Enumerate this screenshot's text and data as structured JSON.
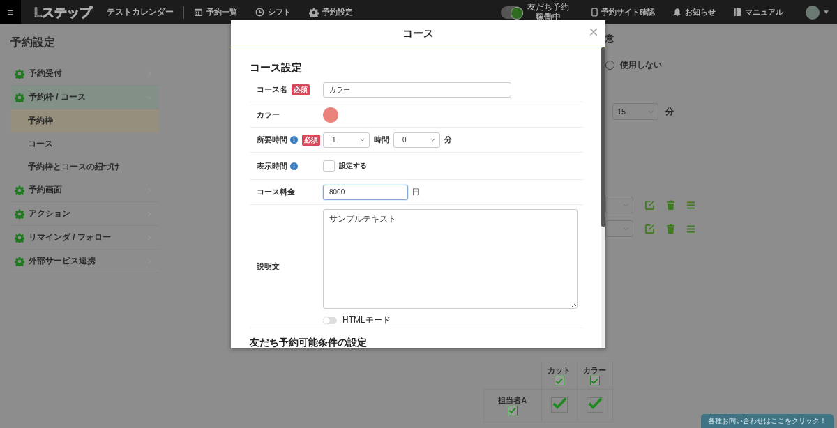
{
  "topbar": {
    "menu": "≡",
    "logo": "Lステップ",
    "calendar_name": "テストカレンダー",
    "nav": [
      {
        "label": "予約一覧"
      },
      {
        "label": "シフト"
      },
      {
        "label": "予約設定"
      }
    ],
    "status_toggle": {
      "caption": "友だち予約",
      "label": "稼働中",
      "on": true
    },
    "links": [
      {
        "label": "予約サイト確認"
      },
      {
        "label": "お知らせ"
      },
      {
        "label": "マニュアル"
      }
    ]
  },
  "sidebar": {
    "title": "予約設定",
    "items": [
      {
        "label": "予約受付",
        "expanded": false
      },
      {
        "label": "予約枠 / コース",
        "expanded": true,
        "children": [
          {
            "label": "予約枠",
            "selected": true
          },
          {
            "label": "コース",
            "selected": false
          },
          {
            "label": "予約枠とコースの紐づけ",
            "selected": false
          }
        ]
      },
      {
        "label": "予約画面",
        "expanded": false
      },
      {
        "label": "アクション",
        "expanded": false
      },
      {
        "label": "リマインダ / フォロー",
        "expanded": false
      },
      {
        "label": "外部サービス連携",
        "expanded": false
      }
    ]
  },
  "background": {
    "heading_fragment": "意",
    "radio": {
      "label": "使用しない",
      "selected": false
    },
    "interval": {
      "value": "15",
      "unit": "分"
    },
    "rows": [
      {
        "actions": true
      },
      {
        "actions": true
      }
    ],
    "table": {
      "columns": [
        {
          "label": "カット",
          "checked": true
        },
        {
          "label": "カラー",
          "checked": true
        }
      ],
      "rows": [
        {
          "label": "担当者A",
          "checked": true,
          "cells": [
            true,
            true
          ]
        }
      ]
    }
  },
  "modal": {
    "title": "コース",
    "close": "×",
    "section": "コース設定",
    "fields": [
      {
        "kind": "text",
        "label": "コース名",
        "required": "必須",
        "value": "カラー"
      },
      {
        "kind": "color",
        "label": "カラー",
        "color": "#e8827a"
      },
      {
        "kind": "duration",
        "label": "所要時間",
        "info": true,
        "required": "必須",
        "hours": "1",
        "hours_unit": "時間",
        "minutes": "0",
        "minutes_unit": "分"
      },
      {
        "kind": "checkbox",
        "label": "表示時間",
        "info": true,
        "checked": false,
        "option": "設定する"
      },
      {
        "kind": "price",
        "label": "コース料金",
        "value": "8000",
        "focused": true,
        "unit": "円"
      },
      {
        "kind": "textarea",
        "label": "説明文",
        "value": "サンプルテキスト",
        "toggle": {
          "label": "HTMLモード",
          "on": false
        }
      }
    ],
    "section2": "友だち予約可能条件の設定"
  },
  "help_button": "各種お問い合わせはここをクリック！"
}
